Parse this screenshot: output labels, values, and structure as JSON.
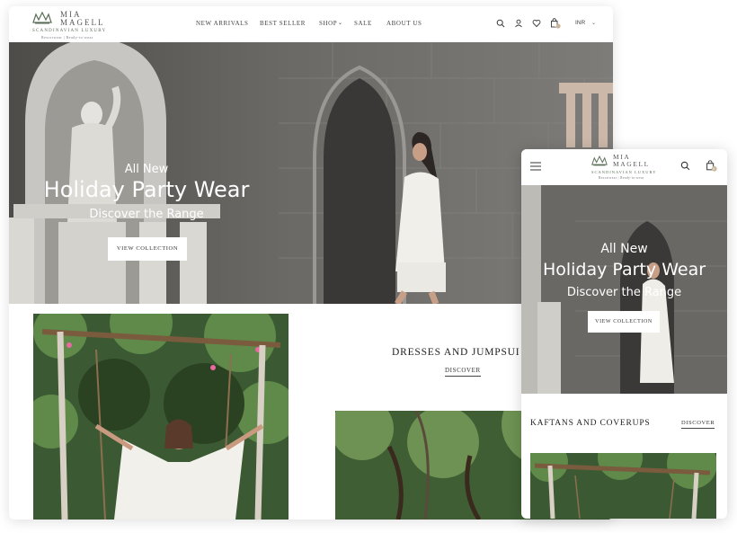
{
  "brand": {
    "name_line1": "MIA",
    "name_line2": "MAGELL",
    "tagline": "SCANDINAVIAN LUXURY",
    "subline": "Resortwear | Ready-to-wear"
  },
  "desktop": {
    "nav": [
      "NEW ARRIVALS",
      "BEST SELLER",
      "SHOP",
      "SALE",
      "ABOUT US"
    ],
    "cart_count": "0",
    "currency": "INR",
    "hero": {
      "kicker": "All New",
      "title": "Holiday Party Wear",
      "subtitle": "Discover the Range",
      "button": "VIEW COLLECTION"
    },
    "section": {
      "title": "DRESSES AND JUMPSUI",
      "link": "DISCOVER"
    }
  },
  "mobile": {
    "cart_count": "0",
    "hero": {
      "kicker": "All New",
      "title": "Holiday Party Wear",
      "subtitle": "Discover the Range",
      "button": "VIEW COLLECTION"
    },
    "section": {
      "title": "KAFTANS AND COVERUPS",
      "link": "DISCOVER"
    }
  },
  "colors": {
    "brand_green": "#5b6e57",
    "text_dark": "#222222",
    "hero_stone": "#5c5a57"
  }
}
